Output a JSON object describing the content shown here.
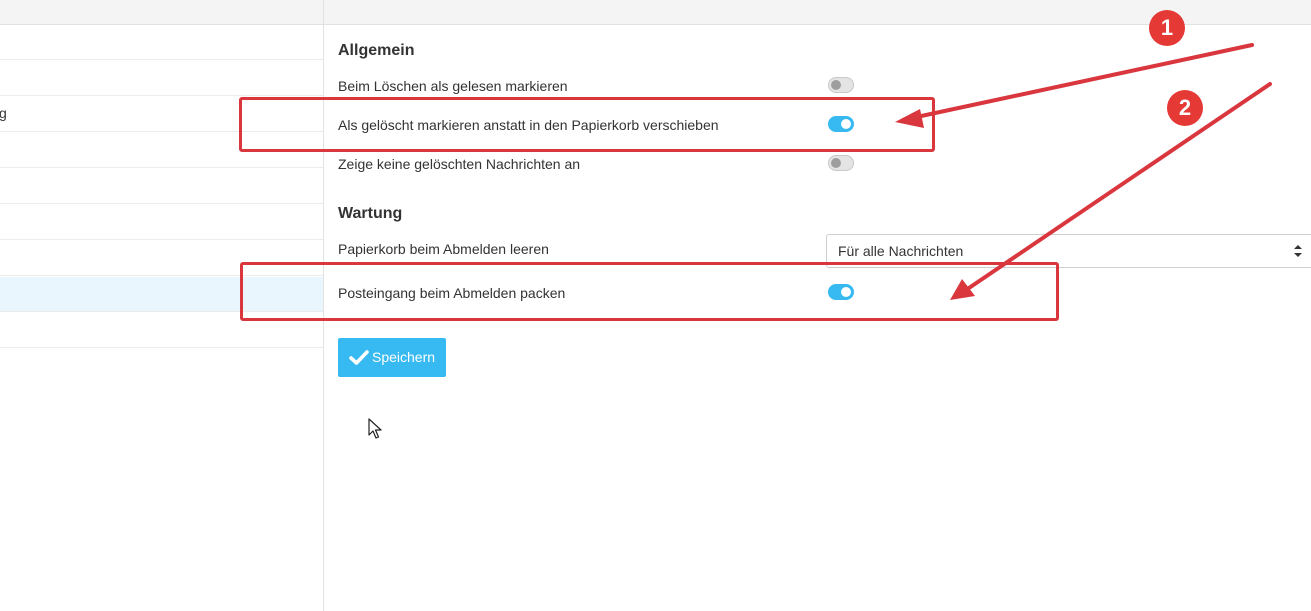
{
  "left_panel": {
    "rows": [
      {
        "text": "",
        "selected": false
      },
      {
        "text": "",
        "selected": false
      },
      {
        "text": "g",
        "selected": false
      },
      {
        "text": "",
        "selected": false
      },
      {
        "text": "",
        "selected": false
      },
      {
        "text": "",
        "selected": false
      },
      {
        "text": "",
        "selected": false
      },
      {
        "text": "",
        "selected": true
      },
      {
        "text": "",
        "selected": false
      }
    ]
  },
  "sections": {
    "general": {
      "title": "Allgemein",
      "settings": [
        {
          "label": "Beim Löschen als gelesen markieren",
          "enabled": false
        },
        {
          "label": "Als gelöscht markieren anstatt in den Papierkorb verschieben",
          "enabled": true
        },
        {
          "label": "Zeige keine gelöschten Nachrichten an",
          "enabled": false
        }
      ]
    },
    "maintenance": {
      "title": "Wartung",
      "empty_trash": {
        "label": "Papierkorb beim Abmelden leeren",
        "selected_option": "Für alle Nachrichten"
      },
      "compact_inbox": {
        "label": "Posteingang beim Abmelden packen",
        "enabled": true
      }
    }
  },
  "save_button": {
    "label": "Speichern",
    "icon": "check-icon"
  },
  "annotations": {
    "badges": [
      "1",
      "2"
    ],
    "color": "#e53935"
  },
  "colors": {
    "accent": "#37b9f1",
    "toggle_off": "#e4e4e4",
    "annotation": "#d9363e"
  }
}
